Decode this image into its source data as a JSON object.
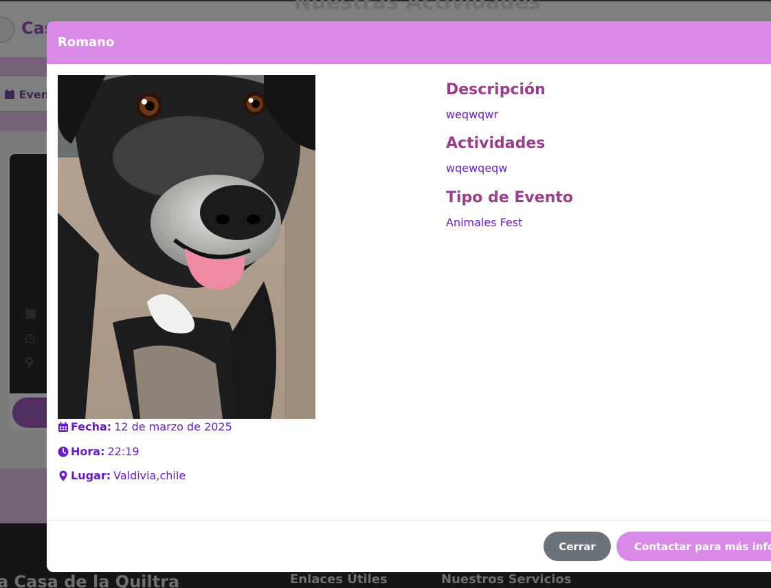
{
  "background": {
    "brand": "Cas",
    "heading": "Nuestras Actividades",
    "nav_item": "Even",
    "footer": {
      "brand": "a Casa de la Quiltra",
      "col1": "Enlaces Útiles",
      "col2": "Nuestros Servicios"
    }
  },
  "modal": {
    "title": "Romano",
    "photo_icon": "dog-photo",
    "details": {
      "fecha_label": "Fecha:",
      "fecha_value": "12 de marzo de 2025",
      "hora_label": "Hora:",
      "hora_value": "22:19",
      "lugar_label": "Lugar:",
      "lugar_value": "Valdivia,chile"
    },
    "sections": {
      "descripcion_title": "Descripción",
      "descripcion_text": "weqwqwr",
      "actividades_title": "Actividades",
      "actividades_text": "wqewqeqw",
      "tipo_title": "Tipo de Evento",
      "tipo_text": "Animales Fest"
    },
    "buttons": {
      "close_label": "Cerrar",
      "contact_label": "Contactar para más información"
    }
  },
  "colors": {
    "header": "#d98ae6",
    "section_title": "#9b3d8c",
    "text_accent": "#6a1bc9",
    "close_button": "#6b727a"
  }
}
